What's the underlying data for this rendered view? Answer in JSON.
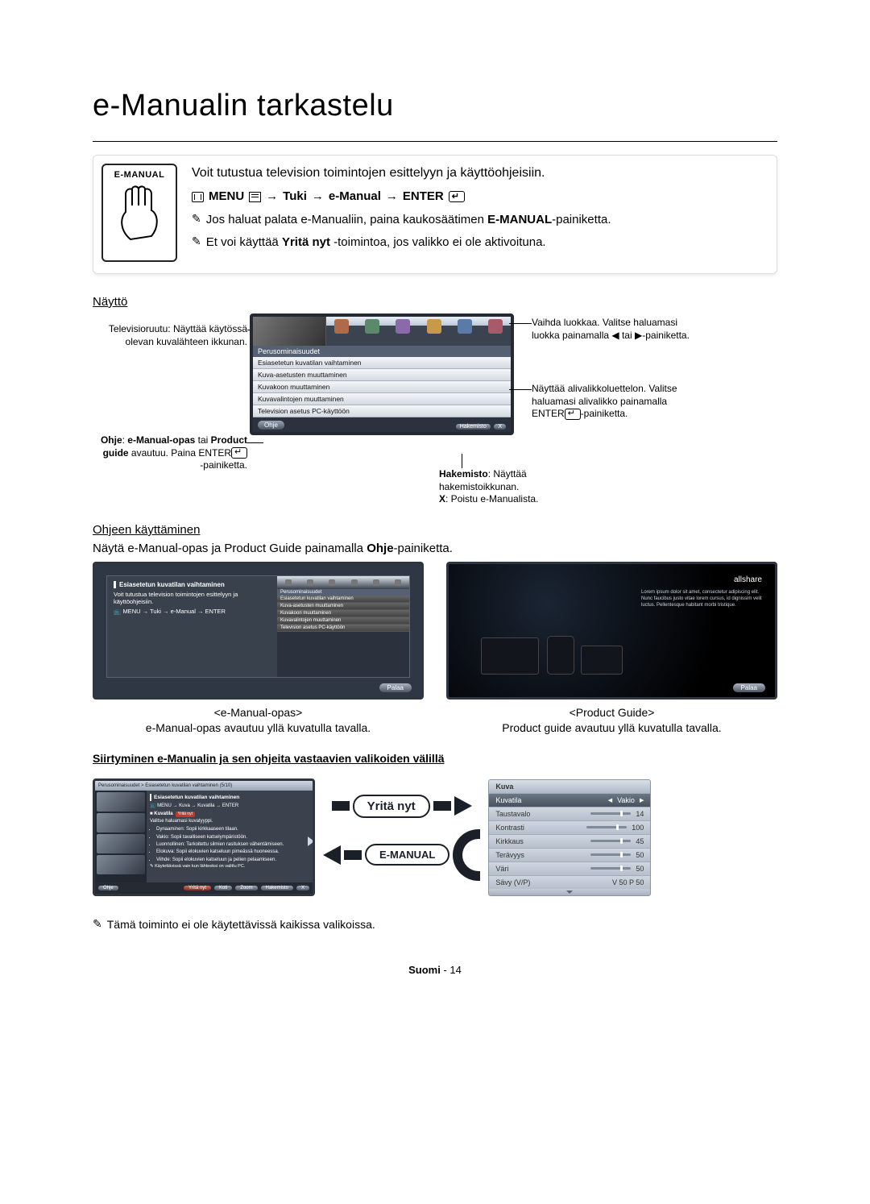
{
  "page_title": "e-Manualin tarkastelu",
  "intro": {
    "button_label": "E-MANUAL",
    "lead": "Voit tutustua television toimintojen esittelyyn ja käyttöohjeisiin.",
    "path_menu": "MENU",
    "path_seg1": "Tuki",
    "path_seg2": "e-Manual",
    "path_enter": "ENTER",
    "note1_pre": "Jos haluat palata e-Manualiin, paina kaukosäätimen ",
    "note1_bold": "E-MANUAL",
    "note1_post": "-painiketta.",
    "note2_pre": "Et voi käyttää ",
    "note2_bold": "Yritä nyt",
    "note2_post": " -toimintoa, jos valikko ei ole aktivoituna."
  },
  "display": {
    "heading": "Näyttö",
    "callout_tv": "Televisioruutu: Näyttää käytössä olevan kuvalähteen ikkunan.",
    "callout_help_pre": "Ohje",
    "callout_help_mid": ": ",
    "callout_help_b1": "e-Manual-opas",
    "callout_help_txt": " tai ",
    "callout_help_b2": "Product guide",
    "callout_help_post": " avautuu. Paina ENTER",
    "callout_help_end": "-painiketta.",
    "callout_cat_pre": "Vaihda luokkaa. Valitse haluamasi luokka painamalla ",
    "callout_cat_post": "-painiketta.",
    "callout_sub_pre": "Näyttää alivalikkoluettelon. Valitse haluamasi alivalikko painamalla ENTER",
    "callout_sub_post": "-painiketta.",
    "callout_idx_b": "Hakemisto",
    "callout_idx_txt": ": Näyttää hakemistoikkunan.",
    "callout_x_b": "X",
    "callout_x_txt": ": Poistu e-Manualista.",
    "screen": {
      "category": "Perusominaisuudet",
      "menu": [
        "Esiasetetun kuvatilan vaihtaminen",
        "Kuva-asetusten muuttaminen",
        "Kuvakoon muuttaminen",
        "Kuvavalintojen muuttaminen",
        "Television asetus PC-käyttöön"
      ],
      "help_btn": "Ohje",
      "index_btn": "Hakemisto",
      "x_btn": "X"
    }
  },
  "help": {
    "heading": "Ohjeen käyttäminen",
    "line_pre": "Näytä e-Manual-opas ja Product Guide painamalla ",
    "line_bold": "Ohje",
    "line_post": "-painiketta.",
    "shot1": {
      "title": "Esiasetetun kuvatilan vaihtaminen",
      "body": "Voit tutustua television toimintojen esittelyyn ja käyttöohjeisiin.",
      "path": "MENU → Tuki → e-Manual → ENTER",
      "cat": "Perusominaisuudet",
      "back": "Palaa"
    },
    "shot2": {
      "brand": "allshare",
      "back": "Palaa"
    },
    "cap1_label": "<e-Manual-opas>",
    "cap1_text": "e-Manual-opas avautuu yllä kuvatulla tavalla.",
    "cap2_label": "<Product Guide>",
    "cap2_text": "Product guide avautuu yllä kuvatulla tavalla."
  },
  "switch": {
    "heading": "Siirtyminen e-Manualin ja sen ohjeita vastaavien valikoiden välillä",
    "try_label": "Yritä nyt",
    "emanual_label": "E-MANUAL",
    "shot": {
      "breadcrumb": "Perusominaisuudet > Esiasetetun kuvatilan vaihtaminen (5/10)",
      "title": "Esiasetetun kuvatilan vaihtaminen",
      "path": "MENU → Kuva → Kuvatila → ENTER",
      "mode_label": "Kuvatila",
      "mode_badge": "Yritä nyt",
      "desc": "Valitse haluamasi kuvatyyppi.",
      "items": [
        "Dynaaminen: Sopii kirkkaaseen tilaan.",
        "Vakio: Sopii tavalliseen katselympäristöön.",
        "Luonnollinen: Tarkoitettu silmien rasituksen vähentämiseen.",
        "Elokuva: Sopii elokuvien katseluun pimeässä huoneessa.",
        "Viihde: Sopii elokuvien katseluun ja pelien pelaamiseen."
      ],
      "footnote_icon_text": "Käytettävissä vain kun lähteeksi on valittu PC.",
      "ftr_help": "Ohje",
      "ftr_try": "Yritä nyt",
      "ftr_home": "Koti",
      "ftr_zoom": "Zoom",
      "ftr_index": "Hakemisto",
      "ftr_x": "X"
    },
    "settings": {
      "header": "Kuva",
      "rows": [
        {
          "label": "Kuvatila",
          "value": "Vakio",
          "highlight": true,
          "arrows": true
        },
        {
          "label": "Taustavalo",
          "value": "14"
        },
        {
          "label": "Kontrasti",
          "value": "100"
        },
        {
          "label": "Kirkkaus",
          "value": "45"
        },
        {
          "label": "Terävyys",
          "value": "50"
        },
        {
          "label": "Väri",
          "value": "50"
        },
        {
          "label": "Sävy (V/P)",
          "value": "V 50      P 50",
          "nobar": true
        }
      ]
    }
  },
  "footnote": "Tämä toiminto ei ole käytettävissä kaikissa valikoissa.",
  "footer_lang": "Suomi",
  "footer_page": "14"
}
